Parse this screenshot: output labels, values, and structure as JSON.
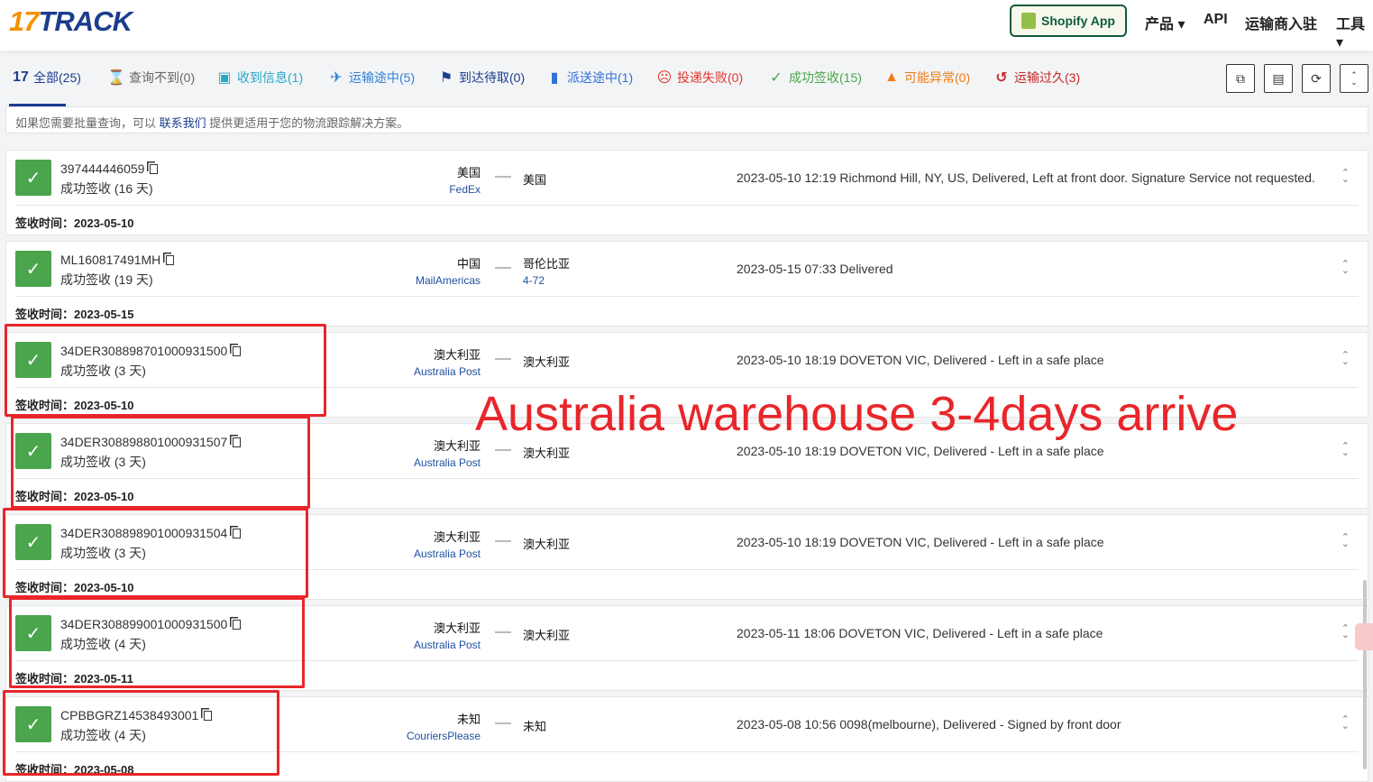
{
  "header": {
    "logo": {
      "num": "17",
      "text": "TRACK"
    },
    "shopify": "Shopify App",
    "nav": [
      "产品 ▾",
      "API",
      "运输商入驻",
      "工具 ▾"
    ]
  },
  "tabs": [
    {
      "icon": "17",
      "label": "全部(25)",
      "color": "#1b3d8f"
    },
    {
      "icon": "⌛",
      "label": "查询不到(0)",
      "color": "#666666"
    },
    {
      "icon": "▣",
      "label": "收到信息(1)",
      "color": "#26a7c8"
    },
    {
      "icon": "✈",
      "label": "运输途中(5)",
      "color": "#2f7fd6"
    },
    {
      "icon": "⚑",
      "label": "到达待取(0)",
      "color": "#1b3d8f"
    },
    {
      "icon": "▮",
      "label": "派送途中(1)",
      "color": "#2f6fd6"
    },
    {
      "icon": "☹",
      "label": "投递失败(0)",
      "color": "#e0362c"
    },
    {
      "icon": "✓",
      "label": "成功签收(15)",
      "color": "#4aa54c"
    },
    {
      "icon": "▲",
      "label": "可能异常(0)",
      "color": "#f07b12"
    },
    {
      "icon": "↺",
      "label": "运输过久(3)",
      "color": "#c62828"
    }
  ],
  "info": {
    "before": "如果您需要批量查询，可以 ",
    "link": "联系我们",
    "after": " 提供更适用于您的物流跟踪解决方案。"
  },
  "sign_label": "签收时间：",
  "shipments": [
    {
      "number": "397444446059",
      "status": "成功签收 (16 天)",
      "from": "美国",
      "from_carrier": "FedEx",
      "to": "美国",
      "to_carrier": "",
      "event": "2023-05-10 12:19  Richmond Hill, NY, US, Delivered, Left at front door. Signature Service not requested.",
      "signed": "2023-05-10"
    },
    {
      "number": "ML160817491MH",
      "status": "成功签收 (19 天)",
      "from": "中国",
      "from_carrier": "MailAmericas",
      "to": "哥伦比亚",
      "to_carrier": "4-72",
      "event": "2023-05-15 07:33  Delivered",
      "signed": "2023-05-15"
    },
    {
      "number": "34DER308898701000931500",
      "status": "成功签收 (3 天)",
      "from": "澳大利亚",
      "from_carrier": "Australia Post",
      "to": "澳大利亚",
      "to_carrier": "",
      "event": "2023-05-10 18:19  DOVETON VIC, Delivered - Left in a safe place",
      "signed": "2023-05-10"
    },
    {
      "number": "34DER308898801000931507",
      "status": "成功签收 (3 天)",
      "from": "澳大利亚",
      "from_carrier": "Australia Post",
      "to": "澳大利亚",
      "to_carrier": "",
      "event": "2023-05-10 18:19  DOVETON VIC, Delivered - Left in a safe place",
      "signed": "2023-05-10"
    },
    {
      "number": "34DER308898901000931504",
      "status": "成功签收 (3 天)",
      "from": "澳大利亚",
      "from_carrier": "Australia Post",
      "to": "澳大利亚",
      "to_carrier": "",
      "event": "2023-05-10 18:19  DOVETON VIC, Delivered - Left in a safe place",
      "signed": "2023-05-10"
    },
    {
      "number": "34DER308899001000931500",
      "status": "成功签收 (4 天)",
      "from": "澳大利亚",
      "from_carrier": "Australia Post",
      "to": "澳大利亚",
      "to_carrier": "",
      "event": "2023-05-11 18:06  DOVETON VIC, Delivered - Left in a safe place",
      "signed": "2023-05-11"
    },
    {
      "number": "CPBBGRZ14538493001",
      "status": "成功签收 (4 天)",
      "from": "未知",
      "from_carrier": "CouriersPlease",
      "to": "未知",
      "to_carrier": "",
      "event": "2023-05-08 10:56  0098(melbourne), Delivered - Signed by front door",
      "signed": "2023-05-08"
    }
  ],
  "annotation": "Australia warehouse 3-4days arrive"
}
